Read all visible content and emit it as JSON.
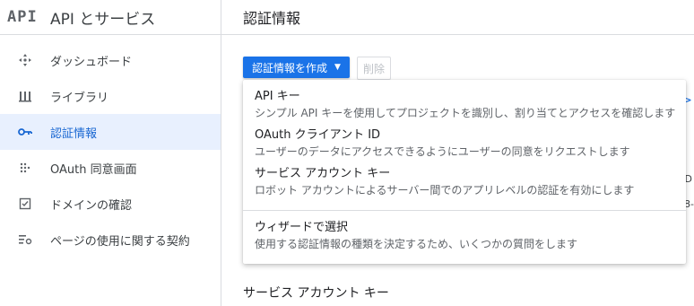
{
  "sidebar": {
    "logo": "API",
    "title": "API とサービス",
    "items": [
      {
        "label": "ダッシュボード",
        "icon": "dashboard-icon"
      },
      {
        "label": "ライブラリ",
        "icon": "library-icon"
      },
      {
        "label": "認証情報",
        "icon": "key-icon",
        "active": true
      },
      {
        "label": "OAuth 同意画面",
        "icon": "oauth-consent-icon"
      },
      {
        "label": "ドメインの確認",
        "icon": "domain-verification-icon"
      },
      {
        "label": "ページの使用に関する契約",
        "icon": "page-usage-agreements-icon"
      }
    ]
  },
  "main": {
    "title": "認証情報",
    "create_button": "認証情報を作成",
    "delete_button": "削除",
    "section_title": "サービス アカウント キー",
    "peek": {
      "d": "D",
      "b": "8-"
    }
  },
  "menu": {
    "items": [
      {
        "title": "API キー",
        "desc": "シンプル API キーを使用してプロジェクトを識別し、割り当てとアクセスを確認します"
      },
      {
        "title": "OAuth クライアント ID",
        "desc": "ユーザーのデータにアクセスできるようにユーザーの同意をリクエストします"
      },
      {
        "title": "サービス アカウント キー",
        "desc": "ロボット アカウントによるサーバー間でのアプリレベルの認証を有効にします"
      },
      {
        "title": "ウィザードで選択",
        "desc": "使用する認証情報の種類を決定するため、いくつかの質問をします"
      }
    ]
  },
  "colors": {
    "accent": "#1a73e8",
    "active_bg": "#e8f0fe",
    "active_text": "#1967d2"
  }
}
